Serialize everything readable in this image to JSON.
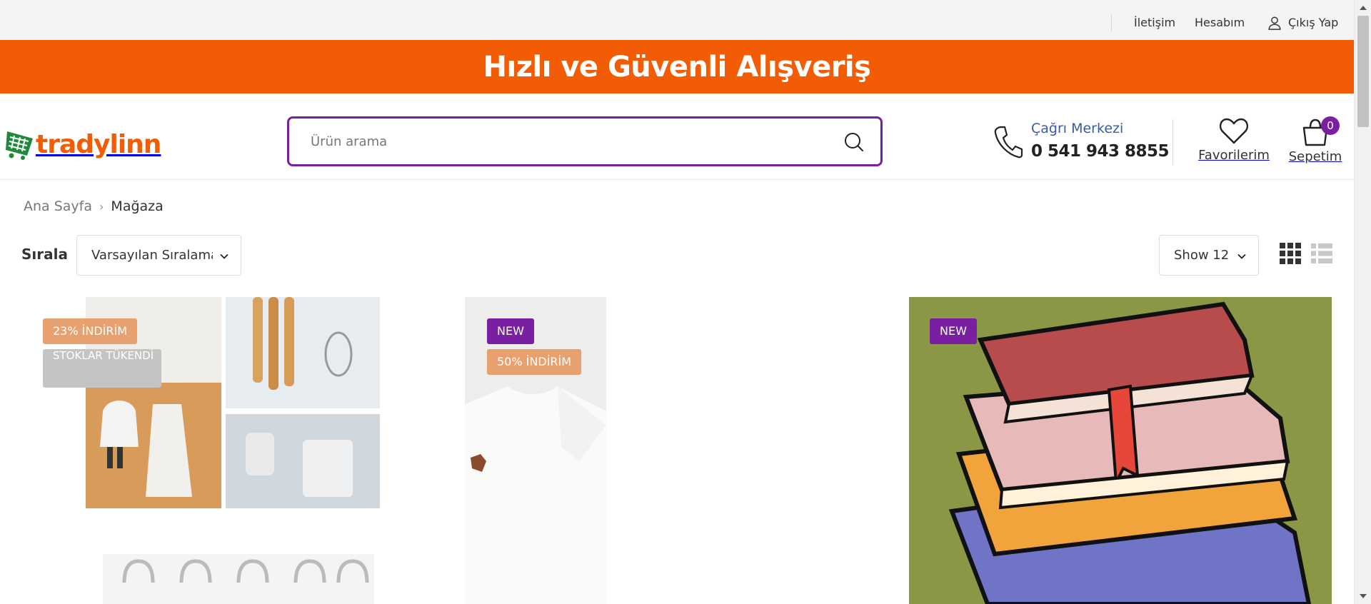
{
  "topbar": {
    "contact": "İletişim",
    "account": "Hesabım",
    "logout": "Çıkış Yap"
  },
  "banner": {
    "text": "Hızlı ve Güvenli Alışveriş",
    "color": "#f25c05"
  },
  "header": {
    "logo_text": "tradylinn",
    "search_placeholder": "Ürün arama",
    "call_center_label": "Çağrı Merkezi",
    "call_center_phone": "0 541 943 8855",
    "favorites_label": "Favorilerim",
    "cart_label": "Sepetim",
    "cart_count": "0"
  },
  "breadcrumb": {
    "home": "Ana Sayfa",
    "current": "Mağaza"
  },
  "toolbar": {
    "sort_label": "Sırala",
    "sort_value": "Varsayılan Sıralama",
    "show_value": "Show 12"
  },
  "products": [
    {
      "tags": [
        "23% İNDİRİM",
        "STOKLAR TÜKENDİ"
      ]
    },
    {
      "tags": [
        "NEW",
        "50% İNDİRİM"
      ]
    },
    {
      "tags": [
        "NEW"
      ]
    }
  ],
  "colors": {
    "accent_purple": "#7b1fa2",
    "brand_orange": "#f25c05",
    "discount_tag": "#e8a06f",
    "soldout_tag": "#c4c4c4"
  }
}
